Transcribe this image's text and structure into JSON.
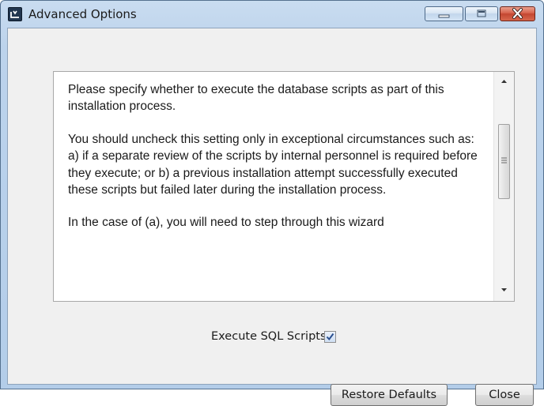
{
  "window": {
    "title": "Advanced Options",
    "icon": "app-logo-icon",
    "caption_buttons": [
      "minimize-icon",
      "maximize-icon",
      "close-icon"
    ],
    "colors": {
      "frame": "#b3cde9",
      "client": "#f0f0f0",
      "close_button": "#c44631"
    }
  },
  "info_text": {
    "paragraphs": [
      "Please specify whether to execute the database scripts as part of this installation process.",
      "You should uncheck this setting only in exceptional circumstances such as:  a) if a separate review of the scripts by internal personnel is required before they execute; or b) a previous installation attempt successfully executed these scripts but failed later during the installation process.",
      "In the case of (a), you will need to step through this wizard"
    ]
  },
  "options": {
    "execute_sql_label": "Execute SQL Scripts?",
    "execute_sql_checked": true
  },
  "buttons": {
    "restore_defaults": "Restore Defaults",
    "close": "Close"
  }
}
